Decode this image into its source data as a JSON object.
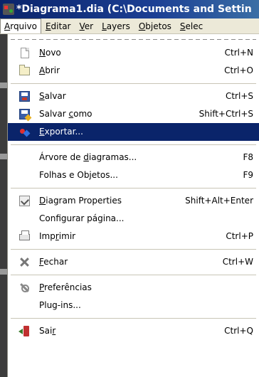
{
  "window": {
    "title": "*Diagrama1.dia (C:\\Documents and Settin"
  },
  "menubar": {
    "items": [
      {
        "pre": "",
        "key": "A",
        "post": "rquivo",
        "open": true
      },
      {
        "pre": "",
        "key": "E",
        "post": "ditar"
      },
      {
        "pre": "",
        "key": "V",
        "post": "er"
      },
      {
        "pre": "",
        "key": "L",
        "post": "ayers"
      },
      {
        "pre": "",
        "key": "O",
        "post": "bjetos"
      },
      {
        "pre": "",
        "key": "S",
        "post": "elec"
      }
    ]
  },
  "menu": {
    "new": {
      "pre": "",
      "key": "N",
      "post": "ovo",
      "accel": "Ctrl+N",
      "icon": "new-document-icon"
    },
    "open": {
      "pre": "",
      "key": "A",
      "post": "brir",
      "accel": "Ctrl+O",
      "icon": "open-folder-icon"
    },
    "save": {
      "pre": "",
      "key": "S",
      "post": "alvar",
      "accel": "Ctrl+S",
      "icon": "save-icon"
    },
    "saveas": {
      "pre": "Salvar ",
      "key": "c",
      "post": "omo",
      "accel": "Shift+Ctrl+S",
      "icon": "save-as-icon"
    },
    "export": {
      "pre": "",
      "key": "E",
      "post": "xportar...",
      "accel": "",
      "icon": "export-icon"
    },
    "tree": {
      "pre": "Árvore de ",
      "key": "d",
      "post": "iagramas...",
      "accel": "F8"
    },
    "sheets": {
      "pre": "Folhas e Objetos...",
      "key": "",
      "post": "",
      "accel": "F9"
    },
    "props": {
      "pre": "",
      "key": "D",
      "post": "iagram Properties",
      "accel": "Shift+Alt+Enter",
      "icon": "properties-icon"
    },
    "pagesetup": {
      "pre": "Configurar página...",
      "key": "",
      "post": "",
      "accel": ""
    },
    "print": {
      "pre": "Imp",
      "key": "r",
      "post": "imir",
      "accel": "Ctrl+P",
      "icon": "printer-icon"
    },
    "close": {
      "pre": "",
      "key": "F",
      "post": "echar",
      "accel": "Ctrl+W",
      "icon": "close-x-icon"
    },
    "prefs": {
      "pre": "",
      "key": "P",
      "post": "referências",
      "accel": "",
      "icon": "preferences-icon"
    },
    "plugins": {
      "pre": "Plug-ins...",
      "key": "",
      "post": "",
      "accel": ""
    },
    "quit": {
      "pre": "Sai",
      "key": "r",
      "post": "",
      "accel": "Ctrl+Q",
      "icon": "quit-icon"
    }
  },
  "colors": {
    "highlight": "#0a246a",
    "titlebar": "#0a246a",
    "menu_bg": "#ffffff"
  }
}
